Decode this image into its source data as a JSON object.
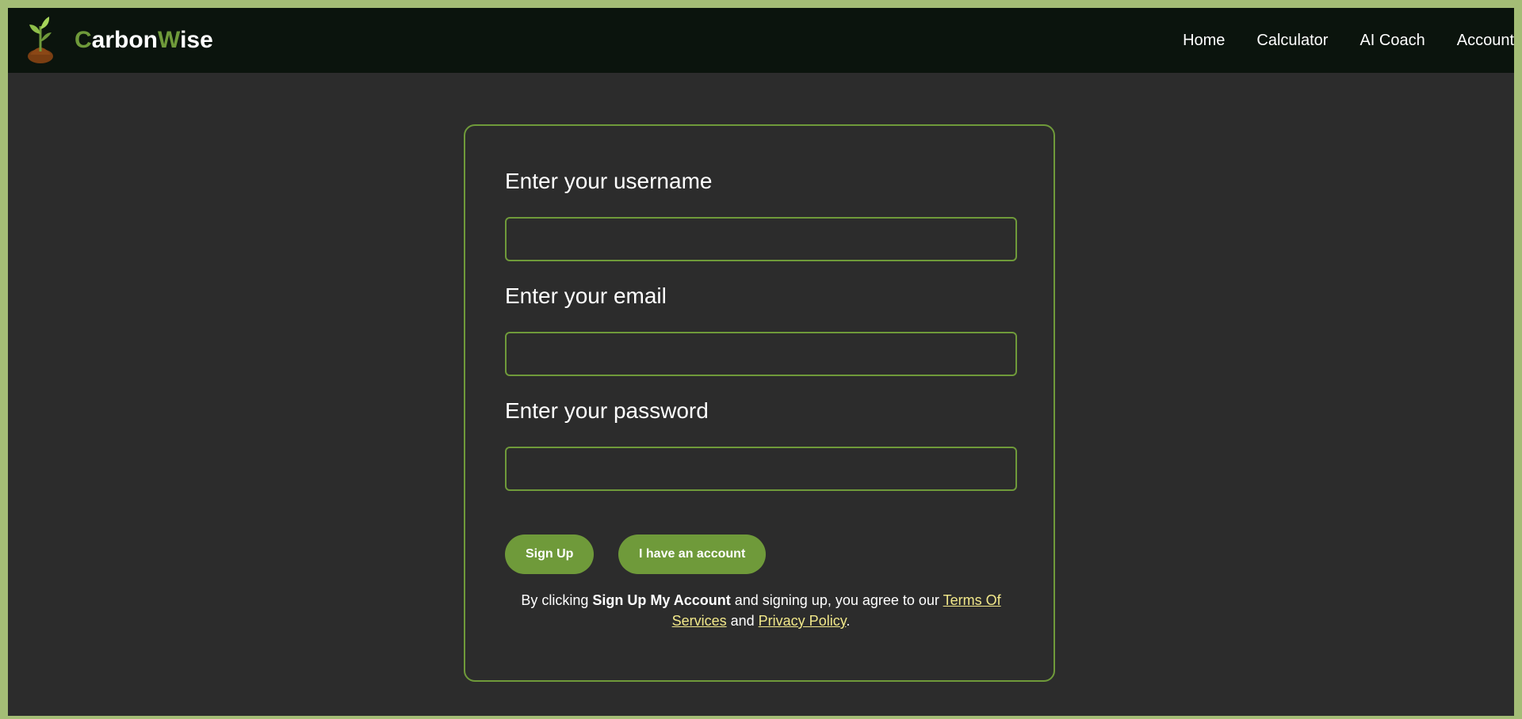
{
  "brand": {
    "name_first_letter": "C",
    "name_middle": "arbon",
    "name_w": "W",
    "name_end": "ise",
    "logo_icon": "sprout-icon",
    "accent_color": "#6f9a3a"
  },
  "nav": {
    "items": [
      {
        "label": "Home"
      },
      {
        "label": "Calculator"
      },
      {
        "label": "AI Coach"
      },
      {
        "label": "Account"
      }
    ]
  },
  "form": {
    "username_label": "Enter your username",
    "username_value": "",
    "email_label": "Enter your email",
    "email_value": "",
    "password_label": "Enter your password",
    "password_value": "",
    "signup_button": "Sign Up",
    "have_account_button": "I have an account"
  },
  "terms": {
    "prefix": "By clicking ",
    "bold": "Sign Up My Account",
    "middle": " and signing up, you agree to our ",
    "tos_link": "Terms Of Services",
    "and_text": " and ",
    "privacy_link": "Privacy Policy",
    "suffix": "."
  },
  "colors": {
    "frame": "#a4bd76",
    "navbar": "#0b140d",
    "background": "#2c2c2c",
    "accent": "#6f9a3a",
    "link": "#f2e88a"
  }
}
